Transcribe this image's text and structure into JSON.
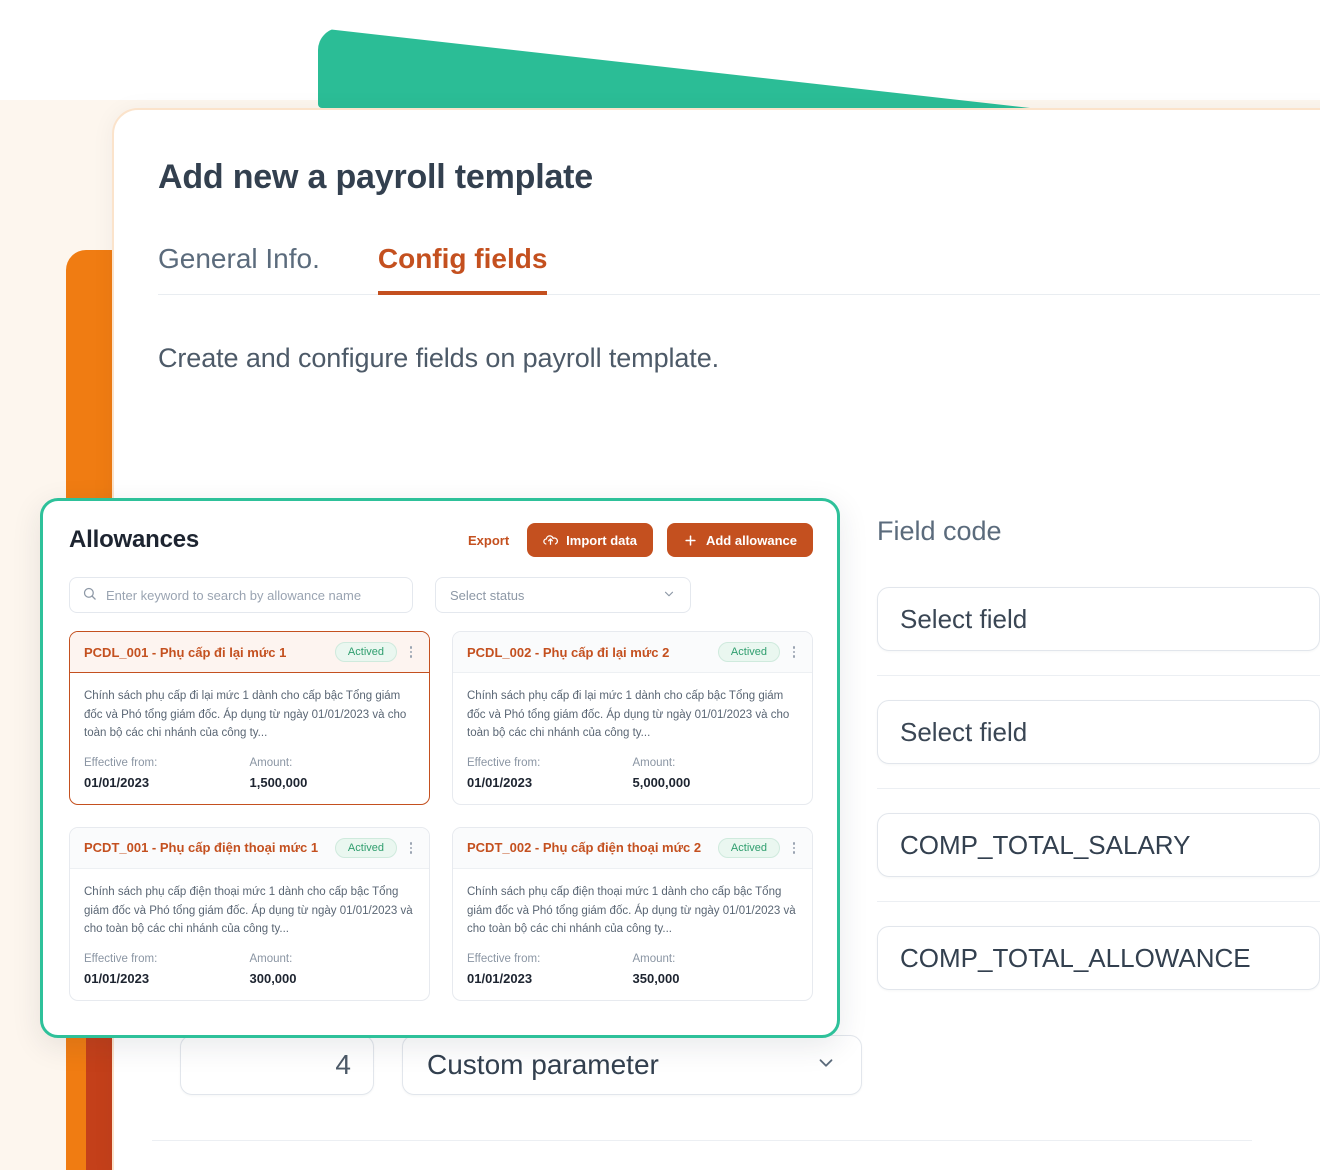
{
  "page": {
    "title": "Add new a payroll template",
    "subtitle": "Create and configure fields on payroll template."
  },
  "tabs": [
    {
      "label": "General Info.",
      "active": false
    },
    {
      "label": "Config fields",
      "active": true
    }
  ],
  "field_code_column": {
    "header": "Field code",
    "rows": [
      {
        "value": "Select field"
      },
      {
        "value": "Select field"
      },
      {
        "value": "COMP_TOTAL_SALARY"
      },
      {
        "value": "COMP_TOTAL_ALLOWANCE"
      }
    ]
  },
  "bottom_row": {
    "order_number": "4",
    "parameter_label": "Custom parameter",
    "chevron_icon": "chevron-down-icon"
  },
  "allowances_panel": {
    "title": "Allowances",
    "export_label": "Export",
    "import_label": "Import data",
    "import_icon": "cloud-upload-icon",
    "add_label": "Add allowance",
    "add_icon": "plus-icon",
    "search": {
      "icon": "search-icon",
      "placeholder": "Enter keyword to search by allowance name",
      "value": ""
    },
    "status_filter": {
      "placeholder": "Select status",
      "chevron_icon": "chevron-down-icon"
    },
    "labels": {
      "effective_from": "Effective from:",
      "amount": "Amount:",
      "kebab_icon": "more-vertical-icon"
    },
    "cards": [
      {
        "code": "PCDL_001 - Phụ cấp đi lại mức 1",
        "status": "Actived",
        "description": "Chính sách phụ cấp đi lại mức 1 dành cho cấp bậc Tổng giám đốc và Phó tổng giám đốc. Áp dụng từ ngày 01/01/2023 và cho toàn bộ các chi nhánh của công ty...",
        "effective_from": "01/01/2023",
        "amount": "1,500,000",
        "selected": true
      },
      {
        "code": "PCDL_002 - Phụ cấp đi lại mức 2",
        "status": "Actived",
        "description": "Chính sách phụ cấp đi lại mức 1 dành cho cấp bậc Tổng giám đốc và Phó tổng giám đốc. Áp dụng từ ngày 01/01/2023 và cho toàn bộ các chi nhánh của công ty...",
        "effective_from": "01/01/2023",
        "amount": "5,000,000",
        "selected": false
      },
      {
        "code": "PCDT_001 - Phụ cấp điện thoại mức 1",
        "status": "Actived",
        "description": "Chính sách phụ cấp điện thoại mức 1 dành cho cấp bậc Tổng giám đốc và Phó tổng giám đốc. Áp dụng từ ngày 01/01/2023 và cho toàn bộ các chi nhánh của công ty...",
        "effective_from": "01/01/2023",
        "amount": "300,000",
        "selected": false
      },
      {
        "code": "PCDT_002 - Phụ cấp điện thoại mức 2",
        "status": "Actived",
        "description": "Chính sách phụ cấp điện thoại mức 1 dành cho cấp bậc Tổng giám đốc và Phó tổng giám đốc. Áp dụng từ ngày 01/01/2023 và cho toàn bộ các chi nhánh của công ty...",
        "effective_from": "01/01/2023",
        "amount": "350,000",
        "selected": false
      }
    ]
  },
  "colors": {
    "brand_orange": "#c4501f",
    "accent_teal": "#2ec19a",
    "decor_orange": "#f07c12",
    "decor_orange_dark": "#c4401a",
    "status_green": "#2f9e6e",
    "text_dark": "#33404f"
  }
}
